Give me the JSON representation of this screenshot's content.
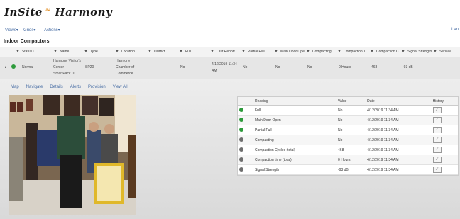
{
  "app": {
    "logo_main": "InSite Harmony"
  },
  "menu": {
    "views": "Views▾",
    "grids": "Grids▾",
    "actions": "Actions▾",
    "right": "Lan"
  },
  "section": {
    "title": "Indoor Compactors"
  },
  "grid": {
    "columns": [
      "Status ↓",
      "Name",
      "Type",
      "Location",
      "District",
      "Full",
      "Last Report",
      "Partial Full",
      "Main Door Ope",
      "Compacting",
      "Compaction Ti",
      "Compaction C",
      "Signal Strength",
      "Serial #"
    ],
    "row": {
      "expand": "▸",
      "status": "Normal",
      "name": [
        "Harmony Visitor's",
        "Center",
        "SmartPack 01"
      ],
      "type": "SP20",
      "location": [
        "Harmony",
        "Chamber of",
        "Commerce"
      ],
      "district": "",
      "full": "No",
      "last_report": [
        "4/12/2019 11:34",
        "AM"
      ],
      "partial_full": "No",
      "main_door": "No",
      "compacting": "No",
      "compaction_time": "0 Hours",
      "compaction_cycles": "468",
      "signal": "-93 dB",
      "serial": ""
    }
  },
  "detail_tabs": [
    "Map",
    "Navigate",
    "Details",
    "Alerts",
    "Provision",
    "View All"
  ],
  "readings": {
    "headers": [
      "Reading",
      "Value",
      "Date",
      "History"
    ],
    "rows": [
      {
        "status": "green",
        "reading": "Full",
        "value": "No",
        "date": "4/12/2019 11:34 AM"
      },
      {
        "status": "green",
        "reading": "Main Door Open",
        "value": "No",
        "date": "4/12/2019 11:34 AM"
      },
      {
        "status": "green",
        "reading": "Partial Full",
        "value": "No",
        "date": "4/12/2019 11:34 AM"
      },
      {
        "status": "grey",
        "reading": "Compacting",
        "value": "No",
        "date": "4/12/2019 11:34 AM"
      },
      {
        "status": "grey",
        "reading": "Compaction Cycles (total)",
        "value": "468",
        "date": "4/12/2019 11:34 AM"
      },
      {
        "status": "grey",
        "reading": "Compaction time (total)",
        "value": "0 Hours",
        "date": "4/12/2019 11:34 AM"
      },
      {
        "status": "grey",
        "reading": "Signal Strength",
        "value": "-93 dB",
        "date": "4/12/2019 11:34 AM"
      }
    ]
  },
  "colors": {
    "ok": "#2e9b3c",
    "neutral": "#6e6e6e",
    "link": "#4a6fa5"
  }
}
